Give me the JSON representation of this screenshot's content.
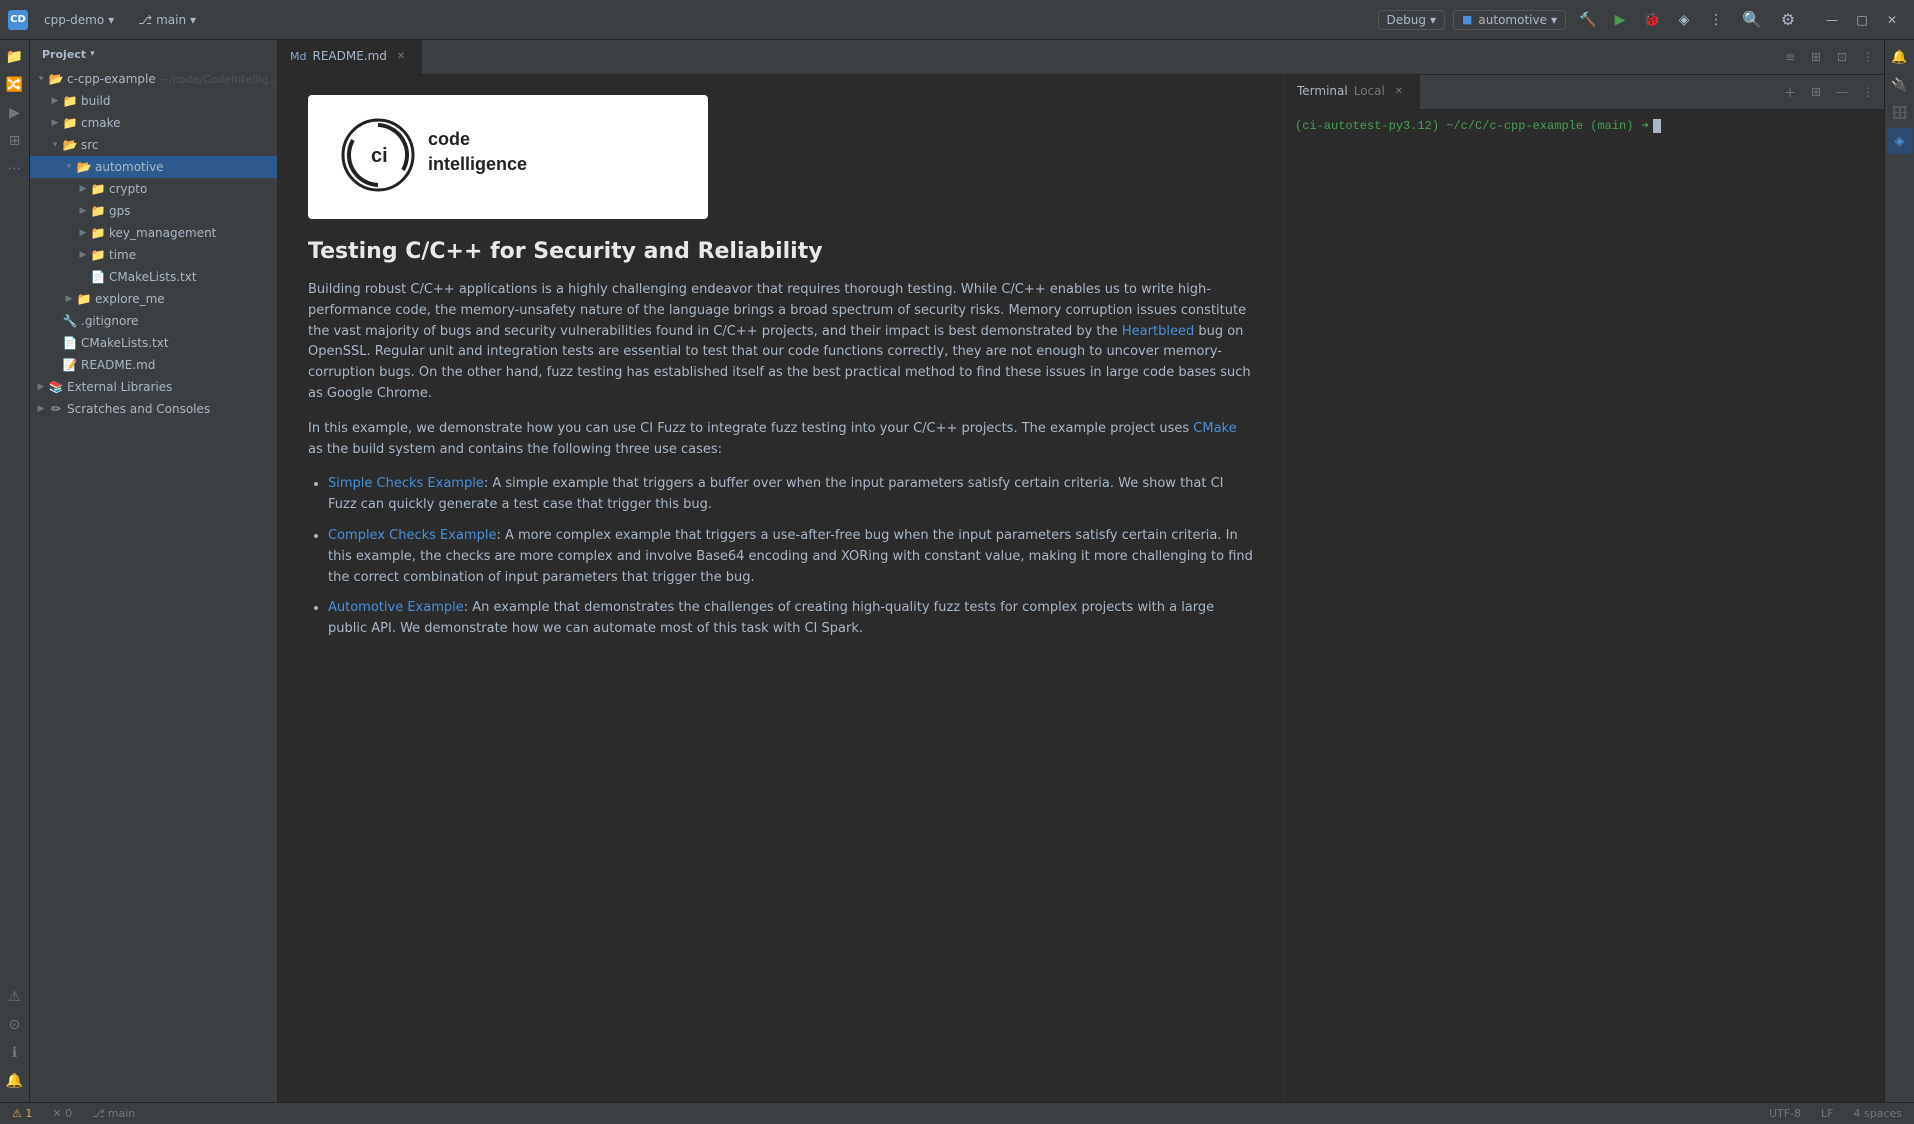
{
  "titlebar": {
    "logo": "CD",
    "project_label": "cpp-demo",
    "branch_label": "main",
    "debug_label": "Debug",
    "config_label": "automotive",
    "chevron": "▾",
    "branch_icon": "⎇",
    "minimize": "—",
    "maximize": "□",
    "close": "✕",
    "search_icon": "🔍",
    "settings_icon": "⚙",
    "more_icon": "⋮",
    "run_icon": "▶",
    "debug_icon": "🐛",
    "build_icon": "🔨",
    "profile_icon": "◈"
  },
  "sidebar": {
    "header_label": "Project",
    "root_item": "c-cpp-example",
    "root_path": "~/code/CodeIntelliger",
    "items": [
      {
        "label": "build",
        "type": "folder",
        "depth": 1,
        "expanded": false
      },
      {
        "label": "cmake",
        "type": "folder",
        "depth": 1,
        "expanded": false
      },
      {
        "label": "src",
        "type": "folder",
        "depth": 1,
        "expanded": true
      },
      {
        "label": "automotive",
        "type": "folder",
        "depth": 2,
        "expanded": true,
        "selected": true
      },
      {
        "label": "crypto",
        "type": "folder",
        "depth": 3,
        "expanded": false
      },
      {
        "label": "gps",
        "type": "folder",
        "depth": 3,
        "expanded": false
      },
      {
        "label": "key_management",
        "type": "folder",
        "depth": 3,
        "expanded": false
      },
      {
        "label": "time",
        "type": "folder",
        "depth": 3,
        "expanded": false
      },
      {
        "label": "CMakeLists.txt",
        "type": "cmake",
        "depth": 3
      },
      {
        "label": "explore_me",
        "type": "folder",
        "depth": 2,
        "expanded": false
      },
      {
        "label": ".gitignore",
        "type": "gitignore",
        "depth": 1
      },
      {
        "label": "CMakeLists.txt",
        "type": "cmake",
        "depth": 1
      },
      {
        "label": "README.md",
        "type": "md",
        "depth": 1
      }
    ],
    "external_libraries_label": "External Libraries",
    "scratches_label": "Scratches and Consoles"
  },
  "tabs": [
    {
      "label": "README.md",
      "active": true,
      "type": "md"
    }
  ],
  "tab_actions": [
    "≡",
    "⊞",
    "⊡",
    "⋮"
  ],
  "markdown": {
    "heading": "Testing C/C++ for Security and Reliability",
    "para1": "Building robust C/C++ applications is a highly challenging endeavor that requires thorough testing. While C/C++ enables us to write high-performance code, the memory-unsafety nature of the language brings a broad spectrum of security risks. Memory corruption issues constitute the vast majority of bugs and security vulnerabilities found in C/C++ projects, and their impact is best demonstrated by the",
    "heartbleed_link": "Heartbleed",
    "para1_cont": "bug on OpenSSL. Regular unit and integration tests are essential to test that our code functions correctly, they are not enough to uncover memory-corruption bugs. On the other hand, fuzz testing has established itself as the best practical method to find these issues in large code bases such as Google Chrome.",
    "para2": "In this example, we demonstrate how you can use CI Fuzz to integrate fuzz testing into your C/C++ projects. The example project uses",
    "cmake_link": "CMake",
    "para2_cont": "as the build system and contains the following three use cases:",
    "list_items": [
      {
        "link": "Simple Checks Example",
        "text": ": A simple example that triggers a buffer over when the input parameters satisfy certain criteria. We show that CI Fuzz can quickly generate a test case that trigger this bug."
      },
      {
        "link": "Complex Checks Example",
        "text": ": A more complex example that triggers a use-after-free bug when the input parameters satisfy certain criteria. In this example, the checks are more complex and involve Base64 encoding and XORing with constant value, making it more challenging to find the correct combination of input parameters that trigger the bug."
      },
      {
        "link": "Automotive Example",
        "text": ": An example that demonstrates the challenges of creating high-quality fuzz tests for complex projects with a large public API. We demonstrate how we can automate most of this task with CI Spark."
      }
    ]
  },
  "terminal": {
    "tab_label": "Terminal",
    "tab_type": "Local",
    "prompt": "(ci-autotest-py3.12) ~/c/C/c-cpp-example (main)",
    "prompt_arrow": "➜"
  },
  "status_bar": {
    "warn_count": "⚠ 1",
    "error_count": "✕ 0",
    "branch": "main",
    "encoding": "UTF-8",
    "line_sep": "LF",
    "indent": "4 spaces"
  }
}
